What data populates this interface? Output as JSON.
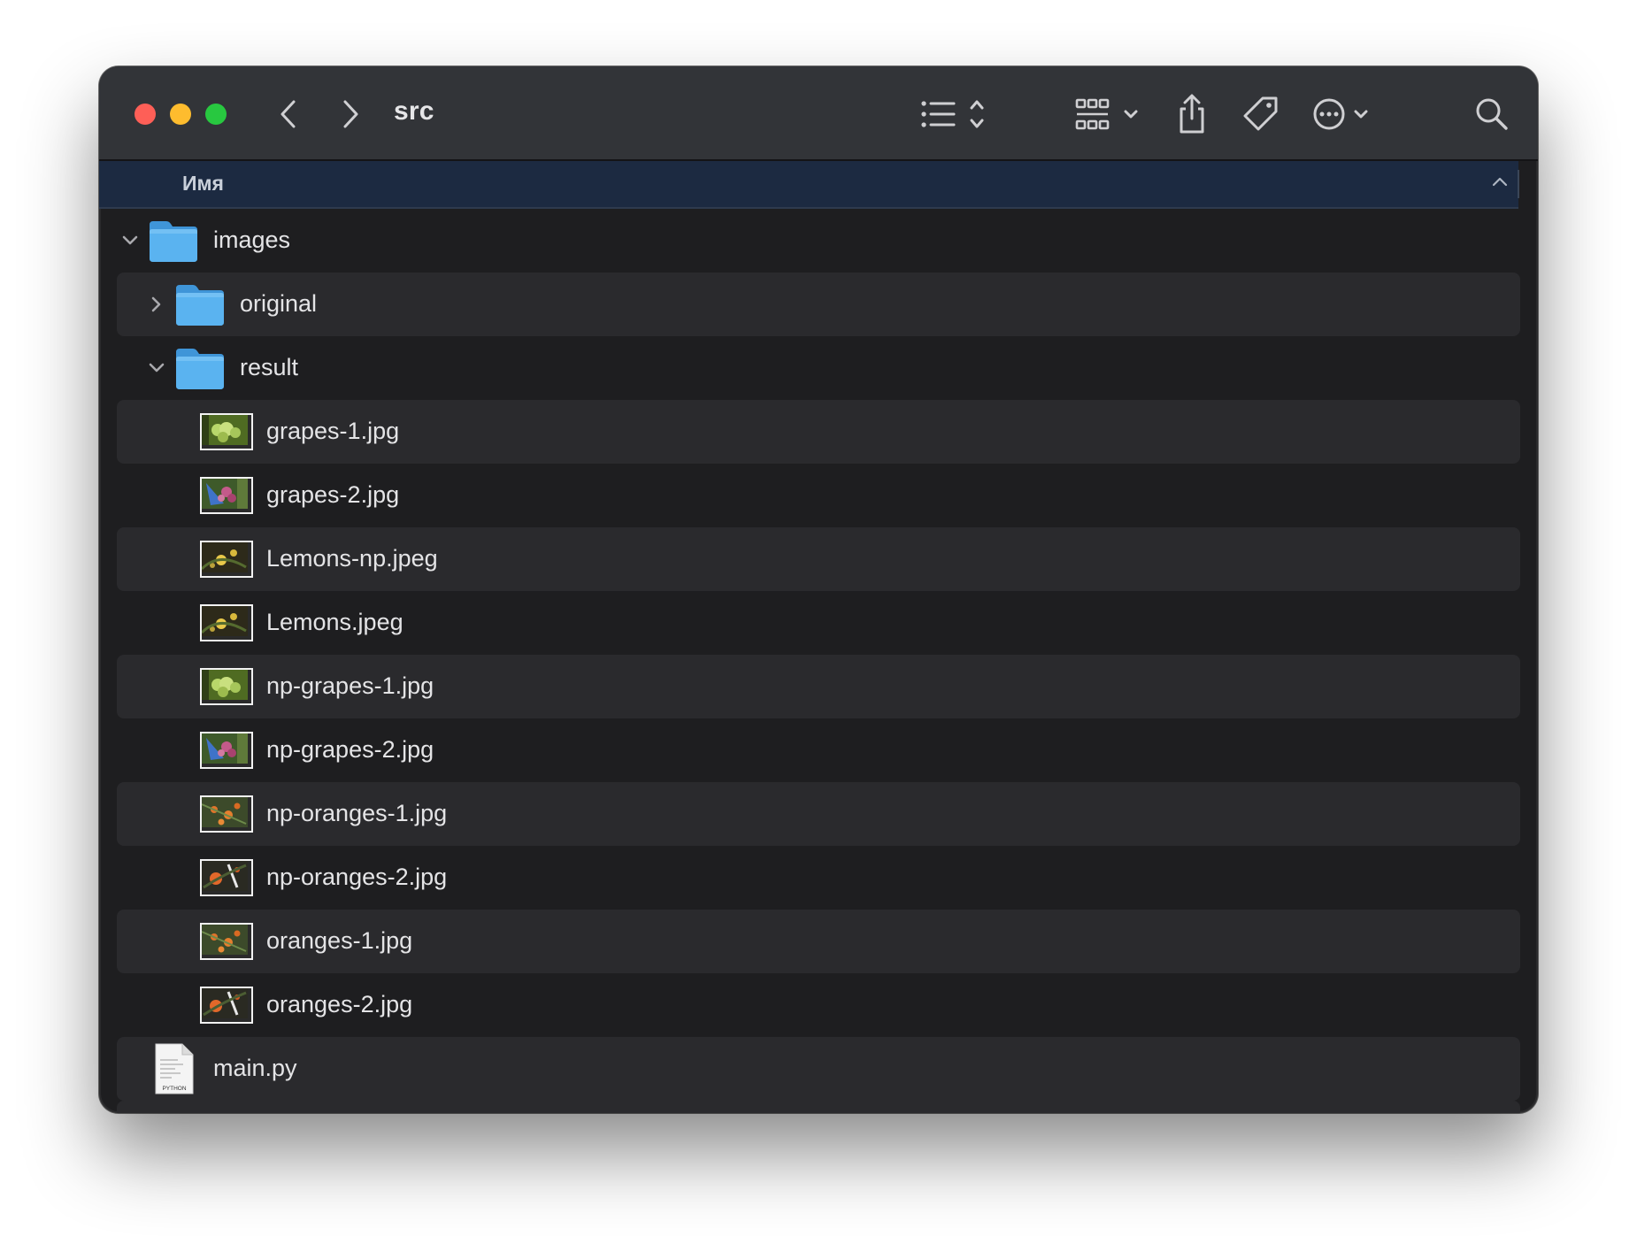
{
  "window": {
    "title": "src"
  },
  "toolbar": {
    "back_icon": "chevron-left-icon",
    "forward_icon": "chevron-right-icon",
    "view_list_icon": "list-view-icon",
    "group_icon": "grid-group-icon",
    "share_icon": "share-icon",
    "tag_icon": "tag-icon",
    "more_icon": "ellipsis-circle-icon",
    "search_icon": "search-icon"
  },
  "column_header": {
    "name": "Имя",
    "sort_direction": "ascending"
  },
  "files": [
    {
      "name": "images",
      "kind": "folder",
      "level": 0,
      "disclosure": "expanded"
    },
    {
      "name": "original",
      "kind": "folder",
      "level": 1,
      "disclosure": "collapsed"
    },
    {
      "name": "result",
      "kind": "folder",
      "level": 1,
      "disclosure": "expanded"
    },
    {
      "name": "grapes-1.jpg",
      "kind": "image",
      "level": 2,
      "thumb": "grapes-green"
    },
    {
      "name": "grapes-2.jpg",
      "kind": "image",
      "level": 2,
      "thumb": "grapes-red"
    },
    {
      "name": "Lemons-np.jpeg",
      "kind": "image",
      "level": 2,
      "thumb": "lemons"
    },
    {
      "name": "Lemons.jpeg",
      "kind": "image",
      "level": 2,
      "thumb": "lemons"
    },
    {
      "name": "np-grapes-1.jpg",
      "kind": "image",
      "level": 2,
      "thumb": "grapes-green"
    },
    {
      "name": "np-grapes-2.jpg",
      "kind": "image",
      "level": 2,
      "thumb": "grapes-red"
    },
    {
      "name": "np-oranges-1.jpg",
      "kind": "image",
      "level": 2,
      "thumb": "oranges-1"
    },
    {
      "name": "np-oranges-2.jpg",
      "kind": "image",
      "level": 2,
      "thumb": "oranges-2"
    },
    {
      "name": "oranges-1.jpg",
      "kind": "image",
      "level": 2,
      "thumb": "oranges-1"
    },
    {
      "name": "oranges-2.jpg",
      "kind": "image",
      "level": 2,
      "thumb": "oranges-2"
    },
    {
      "name": "main.py",
      "kind": "python",
      "level": 0,
      "icon_label": "PYTHON"
    }
  ],
  "colors": {
    "title_bar": "#323438",
    "list_background": "#1e1e20",
    "alt_row": "#2a2a2d",
    "header_bg": "#1c2a41",
    "folder_blue": "#5ab3f0",
    "close": "#fe5f57",
    "minimize": "#febc2e",
    "maximize": "#28c840"
  }
}
